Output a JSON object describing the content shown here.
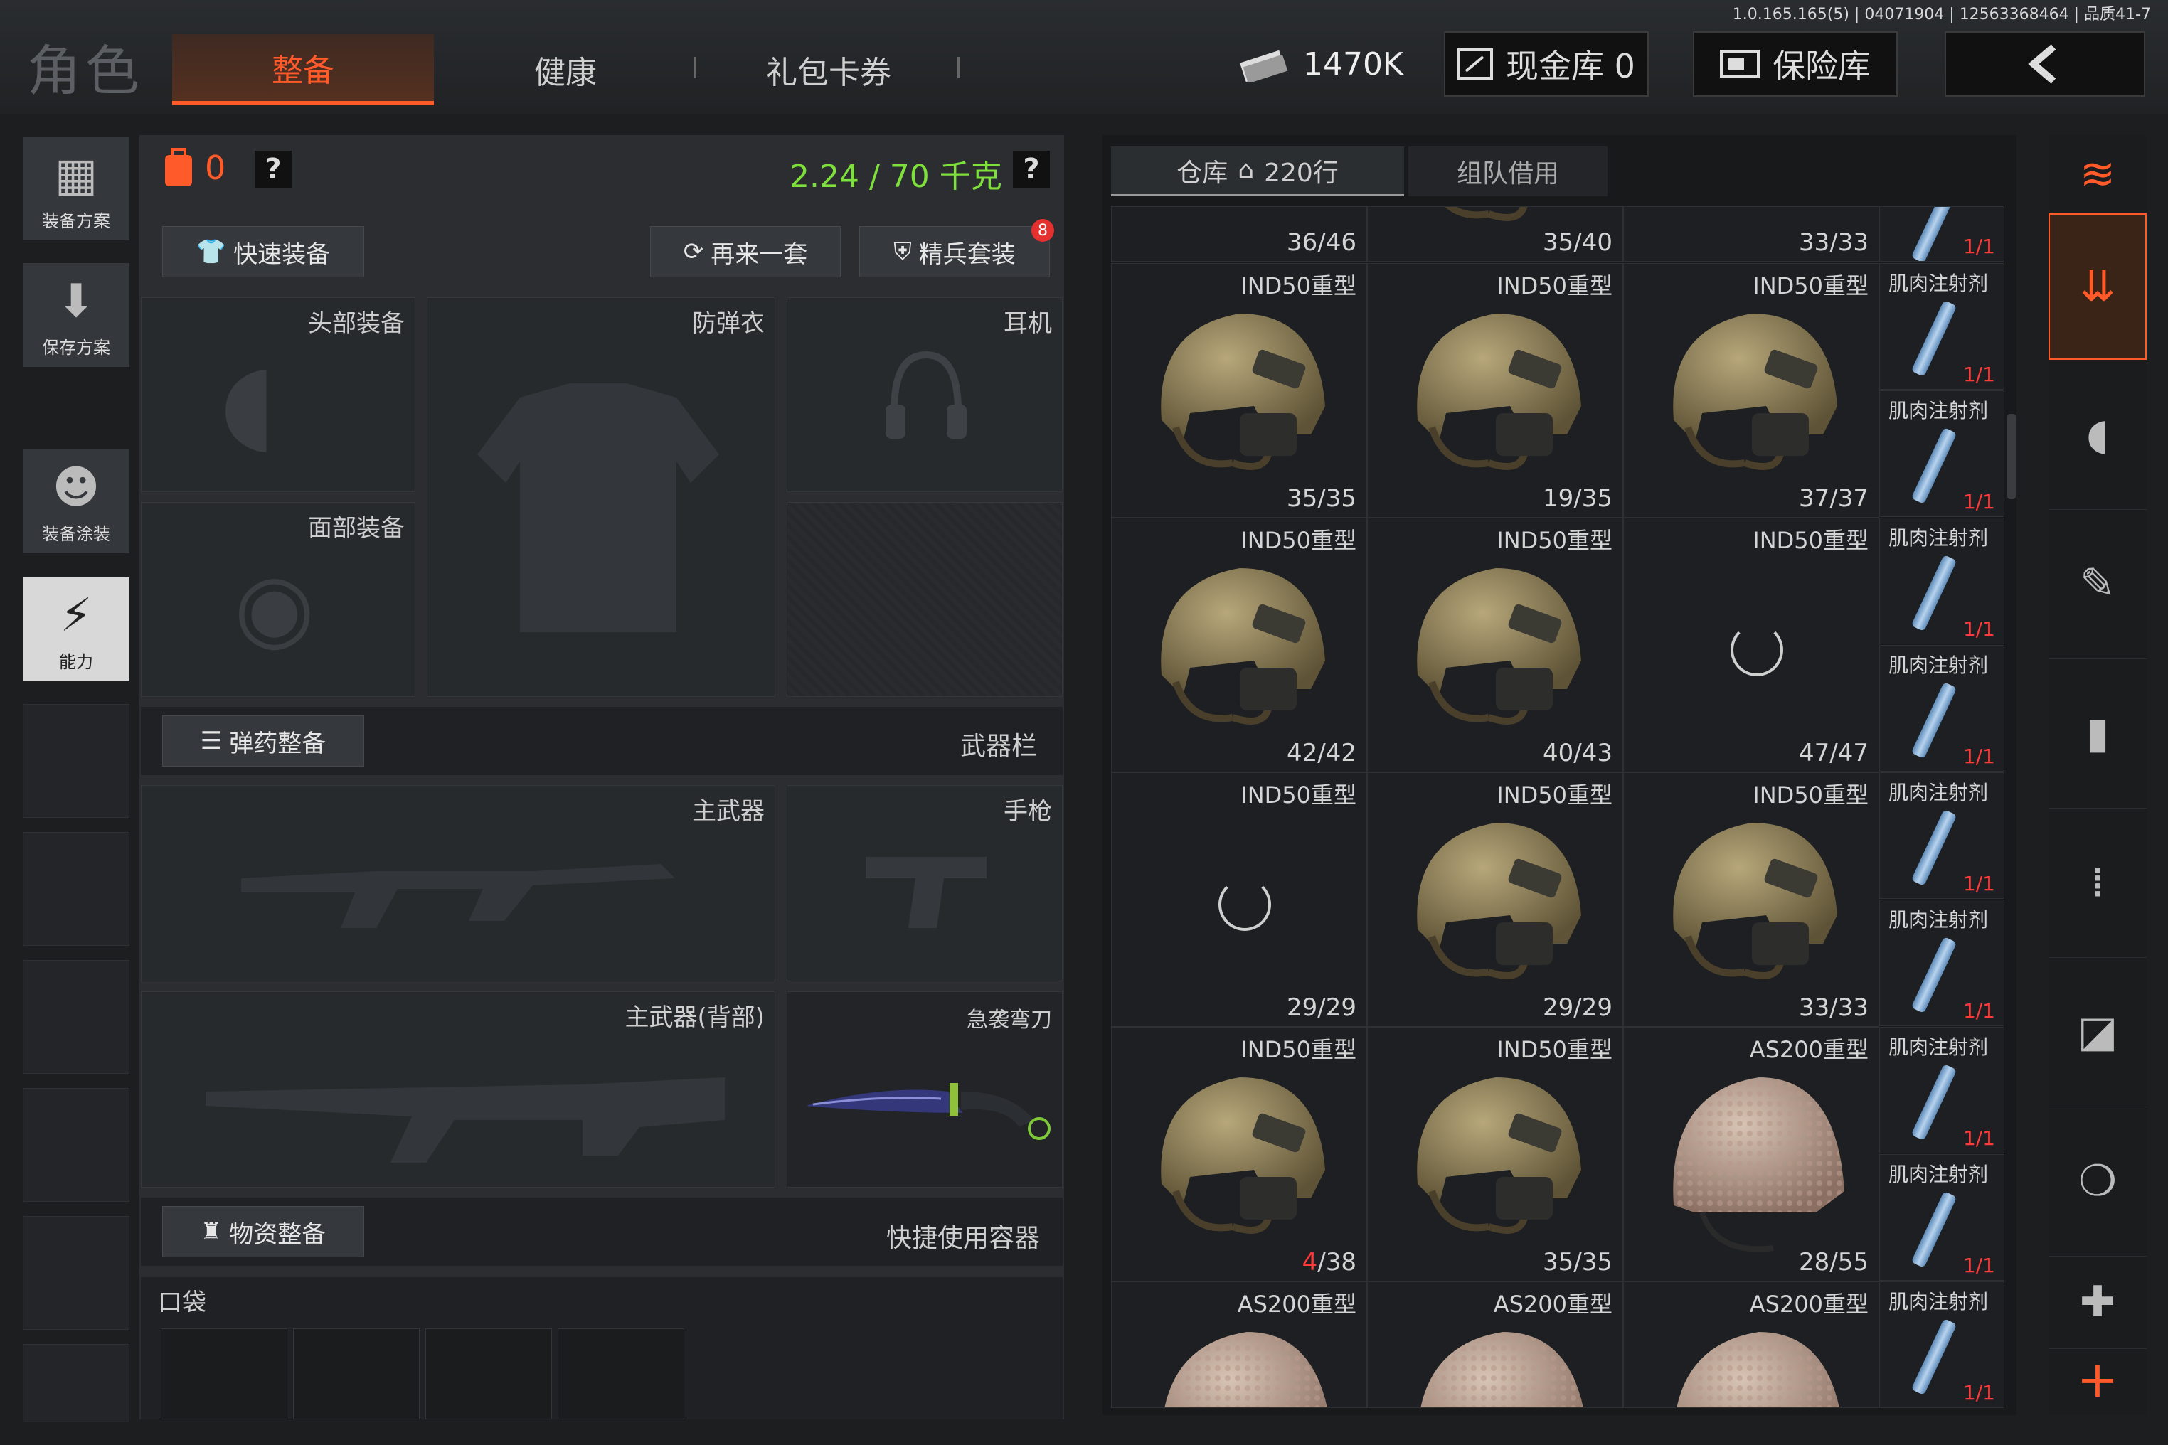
{
  "status": {
    "version": "1.0.165.165(5) | 04071904 | 12563368464 | 品质41-7"
  },
  "header": {
    "title": "角色",
    "tabs": [
      {
        "label": "整备"
      },
      {
        "label": "健康"
      },
      {
        "label": "礼包卡券"
      }
    ],
    "money": "1470K",
    "cash_vault": "现金库 0",
    "safe": "保险库"
  },
  "left_rail": [
    {
      "label": "装备方案"
    },
    {
      "label": "保存方案"
    },
    {
      "label": "装备涂装"
    },
    {
      "label": "能力"
    }
  ],
  "equipment": {
    "count": "0",
    "weight": "2.24 / 70 千克",
    "quick_equip": "快速装备",
    "again": "再来一套",
    "elite": "精兵套装",
    "elite_badge": "8",
    "slots": {
      "head": "头部装备",
      "armor": "防弹衣",
      "headset": "耳机",
      "face": "面部装备",
      "main_weapon": "主武器",
      "pistol": "手枪",
      "main_weapon_back": "主武器(背部)",
      "knife": "急袭弯刀"
    },
    "ammo_button": "弹药整备",
    "weapon_bar": "武器栏",
    "supply_button": "物资整备",
    "quick_container": "快捷使用容器",
    "pocket": "口袋"
  },
  "warehouse": {
    "tab_storage": "仓库",
    "tab_rows": "220行",
    "tab_team": "组队借用",
    "top_row": [
      "36/46",
      "35/40",
      "33/33"
    ],
    "top_syringe": "1/1",
    "rows": [
      [
        {
          "name": "IND50重型",
          "count": "35/35",
          "type": "olive"
        },
        {
          "name": "IND50重型",
          "count": "19/35",
          "type": "olive"
        },
        {
          "name": "IND50重型",
          "count": "37/37",
          "type": "olive"
        }
      ],
      [
        {
          "name": "IND50重型",
          "count": "42/42",
          "type": "olive"
        },
        {
          "name": "IND50重型",
          "count": "40/43",
          "type": "olive"
        },
        {
          "name": "IND50重型",
          "count": "47/47",
          "type": "loading"
        }
      ],
      [
        {
          "name": "IND50重型",
          "count": "29/29",
          "type": "loading"
        },
        {
          "name": "IND50重型",
          "count": "29/29",
          "type": "olive"
        },
        {
          "name": "IND50重型",
          "count": "33/33",
          "type": "olive"
        }
      ],
      [
        {
          "name": "IND50重型",
          "count_red": "4",
          "count_rest": "/38",
          "type": "olive"
        },
        {
          "name": "IND50重型",
          "count": "35/35",
          "type": "olive"
        },
        {
          "name": "AS200重型",
          "count": "28/55",
          "type": "camo"
        }
      ],
      [
        {
          "name": "AS200重型",
          "count": "",
          "type": "camo"
        },
        {
          "name": "AS200重型",
          "count": "",
          "type": "camo"
        },
        {
          "name": "AS200重型",
          "count": "",
          "type": "camo"
        }
      ]
    ],
    "syringe": {
      "name": "肌肉注射剂",
      "count": "1/1"
    }
  },
  "right_rail": [
    "stack-icon",
    "deposit-icon",
    "helmet-icon",
    "rifle-icon",
    "magazine-icon",
    "ammo-icon",
    "sight-icon",
    "grenade-icon",
    "medkit-icon"
  ],
  "colors": {
    "accent": "#ff5a2a",
    "weight": "#7ee03a",
    "red": "#ff3a3a"
  }
}
